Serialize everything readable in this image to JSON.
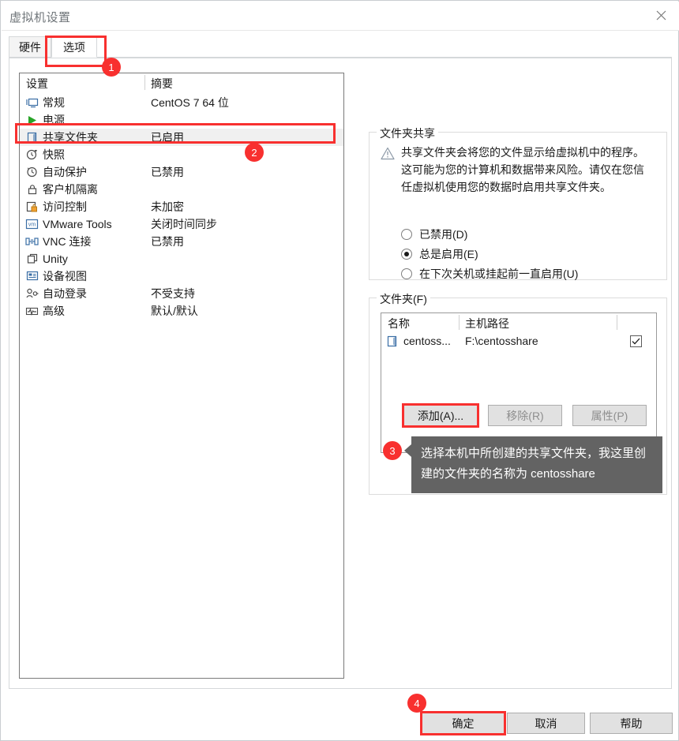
{
  "window": {
    "title": "虚拟机设置",
    "close_icon": "close-icon"
  },
  "tabs": [
    {
      "label": "硬件",
      "active": false
    },
    {
      "label": "选项",
      "active": true
    }
  ],
  "settings_list": {
    "headers": {
      "name": "设置",
      "summary": "摘要"
    },
    "rows": [
      {
        "icon": "monitor-icon",
        "label": "常规",
        "value": "CentOS 7 64 位",
        "selected": false
      },
      {
        "icon": "power-play-icon",
        "label": "电源",
        "value": "",
        "selected": false
      },
      {
        "icon": "shared-folder-icon",
        "label": "共享文件夹",
        "value": "已启用",
        "selected": true
      },
      {
        "icon": "snapshot-clock-icon",
        "label": "快照",
        "value": "",
        "selected": false
      },
      {
        "icon": "autoprotect-icon",
        "label": "自动保护",
        "value": "已禁用",
        "selected": false
      },
      {
        "icon": "lock-icon",
        "label": "客户机隔离",
        "value": "",
        "selected": false
      },
      {
        "icon": "access-control-icon",
        "label": "访问控制",
        "value": "未加密",
        "selected": false
      },
      {
        "icon": "vmware-tools-icon",
        "label": "VMware Tools",
        "value": "关闭时间同步",
        "selected": false
      },
      {
        "icon": "vnc-icon",
        "label": "VNC 连接",
        "value": "已禁用",
        "selected": false
      },
      {
        "icon": "unity-icon",
        "label": "Unity",
        "value": "",
        "selected": false
      },
      {
        "icon": "device-view-icon",
        "label": "设备视图",
        "value": "",
        "selected": false
      },
      {
        "icon": "auto-login-icon",
        "label": "自动登录",
        "value": "不受支持",
        "selected": false
      },
      {
        "icon": "advanced-icon",
        "label": "高级",
        "value": "默认/默认",
        "selected": false
      }
    ]
  },
  "folder_sharing": {
    "group_title": "文件夹共享",
    "warning_icon": "warning-triangle-icon",
    "warning_text": "共享文件夹会将您的文件显示给虚拟机中的程序。这可能为您的计算机和数据带来风险。请仅在您信任虚拟机使用您的数据时启用共享文件夹。",
    "options": [
      {
        "label": "已禁用(D)",
        "selected": false
      },
      {
        "label": "总是启用(E)",
        "selected": true
      },
      {
        "label": "在下次关机或挂起前一直启用(U)",
        "selected": false
      }
    ]
  },
  "folders": {
    "group_title": "文件夹(F)",
    "headers": {
      "name": "名称",
      "path": "主机路径",
      "enabled": ""
    },
    "rows": [
      {
        "icon": "shared-folder-icon",
        "name": "centoss...",
        "path": "F:\\centosshare",
        "checked": true
      }
    ],
    "buttons": [
      {
        "id": "add",
        "label": "添加(A)...",
        "disabled": false
      },
      {
        "id": "remove",
        "label": "移除(R)",
        "disabled": true
      },
      {
        "id": "property",
        "label": "属性(P)",
        "disabled": true
      }
    ]
  },
  "dialog_buttons": [
    {
      "id": "ok",
      "label": "确定"
    },
    {
      "id": "cancel",
      "label": "取消"
    },
    {
      "id": "help",
      "label": "帮助"
    }
  ],
  "annotations": {
    "badges": [
      "1",
      "2",
      "3",
      "4"
    ],
    "callout_text": "选择本机中所创建的共享文件夹，我这里创建的文件夹的名称为 centosshare",
    "highlight_color": "#f8302f",
    "callout_bg": "#636363"
  }
}
